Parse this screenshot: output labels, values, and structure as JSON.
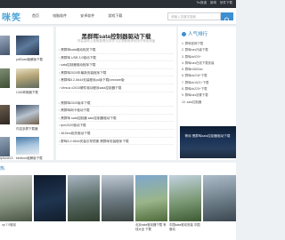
{
  "topbar": {
    "links": [
      "Tin报道",
      "新闻",
      "软件下载"
    ]
  },
  "header": {
    "logo": "咪笑",
    "nav": [
      "首页",
      "电脑软件",
      "安卓软件",
      "游戏下载"
    ],
    "search_placeholder": "请输入关键字搜索"
  },
  "left": {
    "heading": "",
    "thumbs": [
      {
        "label": "pdf2cad破解版下载"
      },
      {
        "label": "CAD转换器下载"
      },
      {
        "label": "内容多屏下载器"
      },
      {
        "label": "kinekon破解版下载"
      },
      {
        "label": "iphone13"
      }
    ]
  },
  "center": {
    "title": "黑群晖sata控制器驱动下载",
    "subtitle": "内容由网上搜索整理仅供学习交流使用请勿用于商业用途",
    "items_a": [
      "黑群晖sata驱动相关下载",
      "黑群晖 USB 3.0驱动下载",
      "sata控制器驱动程序下载",
      "黑群晖2020年最新安装程序下载",
      "黑群晖5.2-5644安装程序pc版下载(vmware版",
      "Versus x2010硬件驱动程序sata控制器下载"
    ],
    "items_b": [
      "黑群晖2020版本下载",
      "黑群晖网卡驱动下载",
      "黑群晖 sata控制器 sata控制器驱动下载",
      "fpm2020驱动下载",
      "3615xs相关驱动下载",
      "群晖5.2-5644安装引导镜像 黑群晖安装程序下载"
    ]
  },
  "right": {
    "heading": "人气排行",
    "items": [
      "1. 群晖官网下载",
      "2. 群晖nas升级下载",
      "3. 群晖ds920+",
      "4. 群晖nas在线下载安装",
      "5. 群晖rt2600ac",
      "6. 群晖ds218+下载",
      "7. 群晖ds1621+下载",
      "8. 群晖ds220+下载",
      "9. 群晖nas设置下载",
      "10. sata控制器"
    ],
    "image_caption": "等待 黑群晖sata控制器驱动下载"
  },
  "bottom": {
    "heading": "热",
    "items": [
      {
        "caption": "xp 7.0驱动"
      },
      {
        "caption": ""
      },
      {
        "caption": ""
      },
      {
        "caption": ""
      },
      {
        "caption": "北京sata驱动器下载 有线大全 下载"
      },
      {
        "caption": "中国sata驱动安装 中国 驱动"
      },
      {
        "caption": ""
      }
    ]
  },
  "colors": {
    "accent": "#2f7fb8",
    "topbar": "#2b3036",
    "page_bg": "#eef1f4"
  }
}
